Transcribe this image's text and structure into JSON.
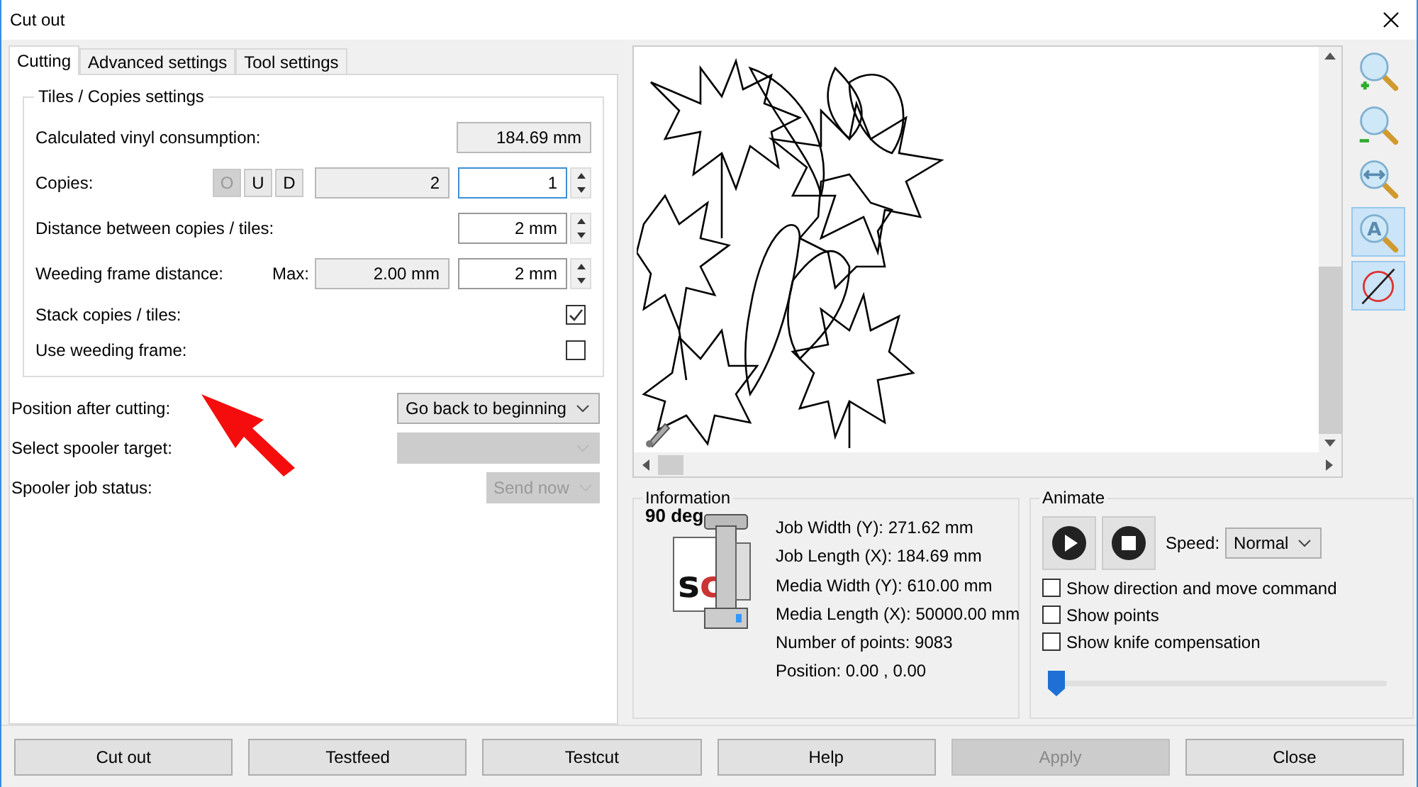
{
  "window": {
    "title": "Cut out"
  },
  "tabs": [
    {
      "label": "Cutting",
      "selected": true
    },
    {
      "label": "Advanced settings",
      "selected": false
    },
    {
      "label": "Tool settings",
      "selected": false
    }
  ],
  "tiles_group": {
    "title": "Tiles / Copies settings",
    "vinyl": {
      "label": "Calculated vinyl consumption:",
      "value": "184.69 mm"
    },
    "copies": {
      "label": "Copies:",
      "buttons": [
        {
          "label": "O",
          "disabled": true
        },
        {
          "label": "U",
          "disabled": false
        },
        {
          "label": "D",
          "disabled": false
        }
      ],
      "total": "2",
      "value": "1"
    },
    "distance": {
      "label": "Distance between copies / tiles:",
      "value": "2 mm"
    },
    "weeding": {
      "label": "Weeding frame distance:",
      "max_label": "Max:",
      "max_value": "2.00 mm",
      "value": "2 mm"
    },
    "options": [
      {
        "label": "Stack copies / tiles:",
        "checked": true
      },
      {
        "label": "Use weeding frame:",
        "checked": false
      }
    ]
  },
  "selects": [
    {
      "label": "Position after cutting:",
      "value": "Go back to beginning",
      "disabled": false
    },
    {
      "label": "Select spooler target:",
      "disabled": true
    },
    {
      "label": "Spooler job status:",
      "value": "Send now",
      "disabled": true
    }
  ],
  "zoom_tools": [
    {
      "kind": "zoom-in",
      "selected": false
    },
    {
      "kind": "zoom-out",
      "selected": false
    },
    {
      "kind": "fit",
      "selected": false
    },
    {
      "kind": "auto",
      "label": "A",
      "selected": true
    },
    {
      "kind": "no-path",
      "selected": true
    }
  ],
  "information": {
    "title": "Information",
    "angle": "90 deg",
    "logo": "sc",
    "lines": [
      "Job Width (Y): 271.62 mm",
      "Job Length (X): 184.69 mm",
      "Media Width (Y): 610.00 mm",
      "Media Length (X): 50000.00 mm",
      "Number of points: 9083",
      "Position: 0.00 , 0.00"
    ]
  },
  "animate": {
    "title": "Animate",
    "speed_label": "Speed:",
    "speed": "Normal",
    "level": 0,
    "options": [
      {
        "label": "Show direction and move command",
        "checked": false
      },
      {
        "label": "Show points",
        "checked": false
      },
      {
        "label": "Show knife compensation",
        "checked": false
      }
    ]
  },
  "buttons": [
    {
      "label": "Cut out",
      "disabled": false
    },
    {
      "label": "Testfeed",
      "disabled": false
    },
    {
      "label": "Testcut",
      "disabled": false
    },
    {
      "label": "Help",
      "disabled": false
    },
    {
      "label": "Apply",
      "disabled": true
    },
    {
      "label": "Close",
      "disabled": false
    }
  ]
}
